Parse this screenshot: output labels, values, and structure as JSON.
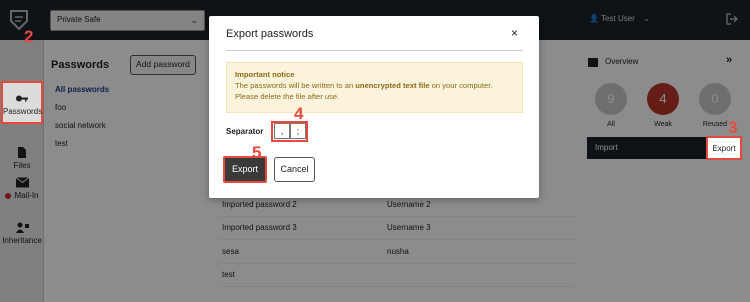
{
  "topbar": {
    "safe_select": "Private Safe",
    "user": "Test User"
  },
  "sidebar": {
    "items": [
      {
        "label": "Passwords",
        "icon": "key-icon"
      },
      {
        "label": "Files",
        "icon": "file-icon"
      },
      {
        "label": "Mail-In",
        "icon": "mail-icon"
      },
      {
        "label": "Inheritance",
        "icon": "inheritance-icon"
      }
    ]
  },
  "main": {
    "heading": "Passwords",
    "add_button": "Add password",
    "categories": [
      "All passwords",
      "foo",
      "social network",
      "test"
    ],
    "rows": [
      {
        "name": "Imported password 2",
        "user": "Username 2"
      },
      {
        "name": "Imported password 3",
        "user": "Username 3"
      },
      {
        "name": "sesa",
        "user": "nusha"
      },
      {
        "name": "test",
        "user": ""
      }
    ]
  },
  "overview": {
    "title": "Overview",
    "more": "»",
    "stats": [
      {
        "value": "9",
        "label": "All",
        "color": "#c9c9c9"
      },
      {
        "value": "4",
        "label": "Weak",
        "color": "#b8362b"
      },
      {
        "value": "0",
        "label": "Reused",
        "color": "#c9c9c9"
      }
    ],
    "import_label": "Import",
    "export_label": "Export"
  },
  "modal": {
    "title": "Export passwords",
    "close": "×",
    "notice_title": "Important notice",
    "notice_line1": "The passwords will be written to an ",
    "notice_bold": "unencrypted text file",
    "notice_line1_end": " on your computer.",
    "notice_line2": "Please delete the file after use.",
    "separator_label": "Separator",
    "separator_options": [
      ",",
      ";"
    ],
    "export_button": "Export",
    "cancel_button": "Cancel"
  },
  "steps": [
    "2",
    "3",
    "4",
    "5"
  ],
  "colors": {
    "accent_red": "#e64a3c",
    "topbar": "#1d2128"
  }
}
